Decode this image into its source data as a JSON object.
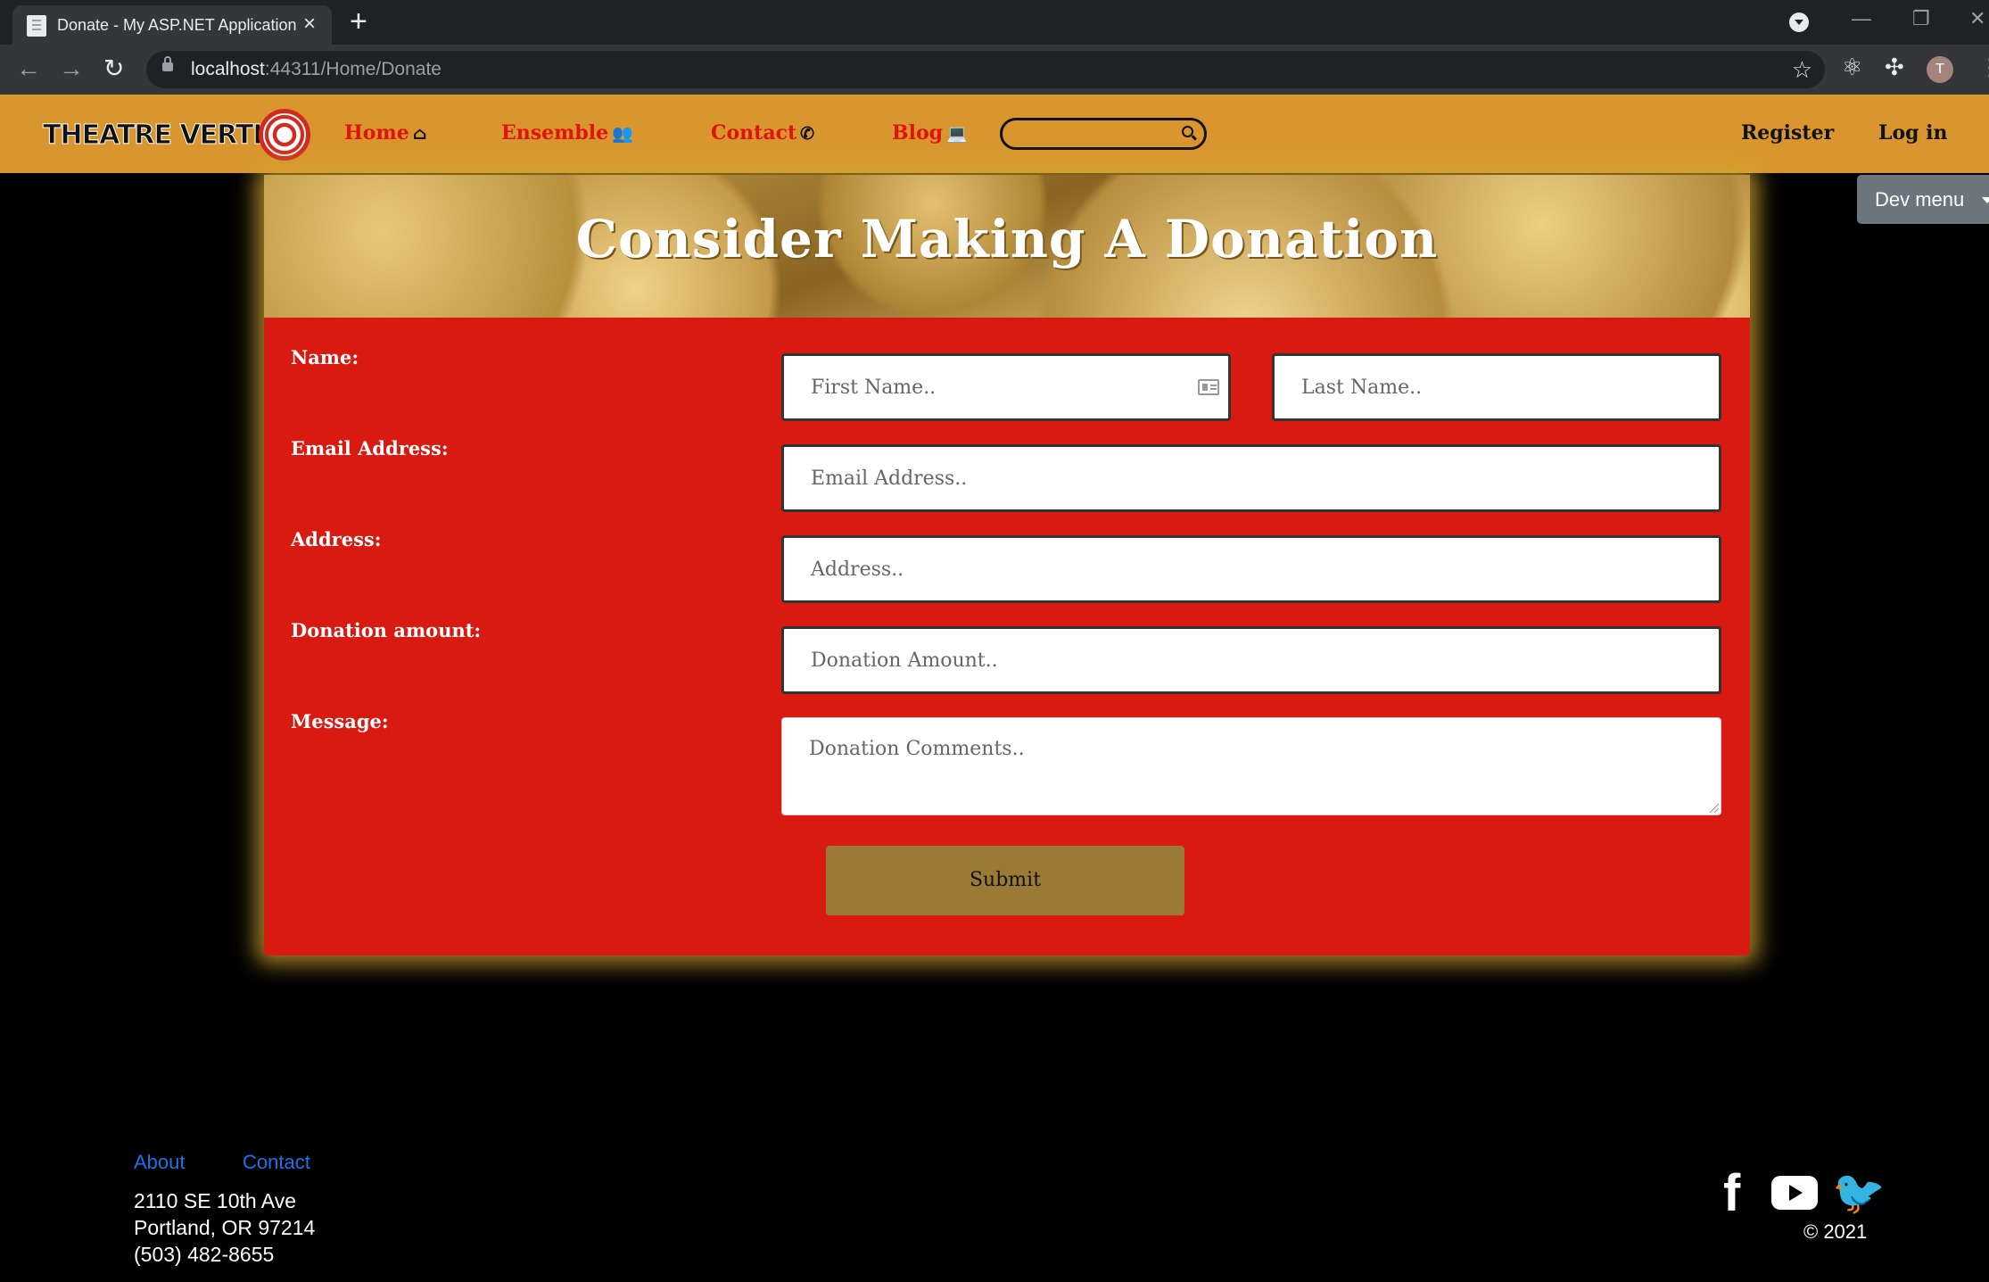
{
  "browser": {
    "tab_title": "Donate - My ASP.NET Application",
    "url_host": "localhost",
    "url_path": ":44311/Home/Donate",
    "profile_initial": "T"
  },
  "navbar": {
    "brand": "THEATRE VERTIGO",
    "links": [
      {
        "label": "Home",
        "icon": "home-icon"
      },
      {
        "label": "Ensemble",
        "icon": "users-icon"
      },
      {
        "label": "Contact",
        "icon": "phone-icon"
      },
      {
        "label": "Blog",
        "icon": "laptop-icon"
      }
    ],
    "search_placeholder": "",
    "register": "Register",
    "login": "Log in",
    "dev_menu": "Dev menu"
  },
  "donation": {
    "title": "Consider Making A Donation",
    "labels": {
      "name": "Name:",
      "email": "Email Address:",
      "address": "Address:",
      "amount": "Donation amount:",
      "message": "Message:"
    },
    "placeholders": {
      "first_name": "First Name..",
      "last_name": "Last Name..",
      "email": "Email Address..",
      "address": "Address..",
      "amount": "Donation Amount..",
      "message": "Donation Comments.."
    },
    "submit": "Submit"
  },
  "footer": {
    "links": [
      "About",
      "Contact"
    ],
    "address": [
      "2110 SE 10th Ave",
      "Portland, OR 97214",
      "(503) 482-8655"
    ],
    "social": [
      "facebook-icon",
      "youtube-icon",
      "twitter-icon"
    ],
    "copyright": "© 2021"
  },
  "colors": {
    "navbar_bg": "#d9962f",
    "nav_link": "#e0140e",
    "form_bg": "#d91a10",
    "submit_bg": "#9b7a36",
    "footer_link": "#1a73e8"
  }
}
